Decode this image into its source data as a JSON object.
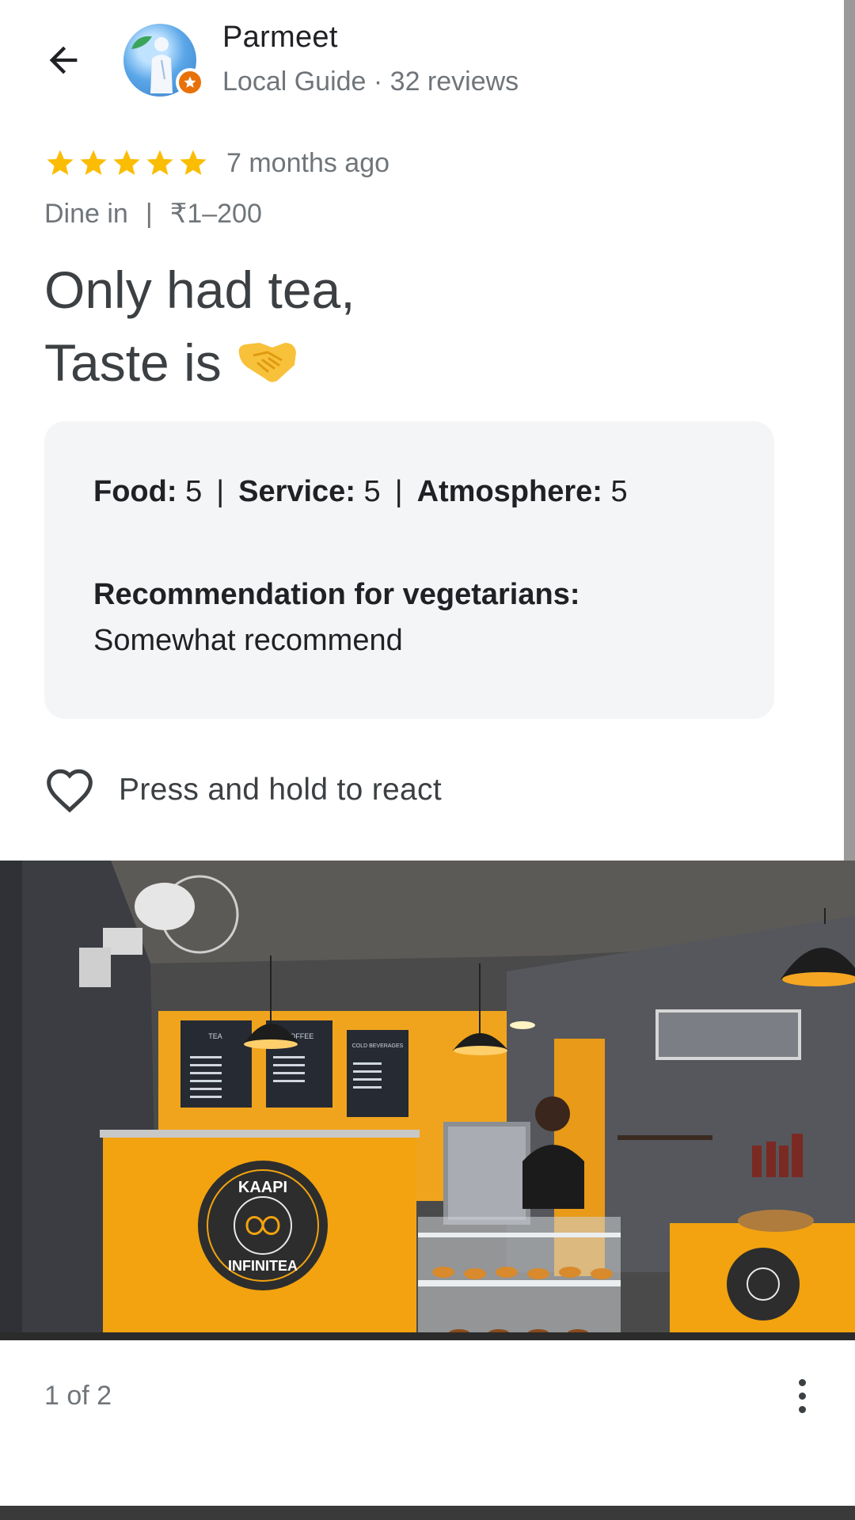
{
  "header": {
    "user_name": "Parmeet",
    "user_meta": "Local Guide · 32 reviews"
  },
  "review": {
    "rating": 5,
    "rating_max": 5,
    "time_ago": "7 months ago",
    "visit_type": "Dine in",
    "visit_separator": "|",
    "price_range": "₹1–200",
    "text_line1": "Only had tea,",
    "text_line2": "Taste is"
  },
  "attributes": {
    "food_label": "Food:",
    "food_value": "5",
    "service_label": "Service:",
    "service_value": "5",
    "atmosphere_label": "Atmosphere:",
    "atmosphere_value": "5",
    "separator": "|",
    "recommendation_label": "Recommendation for vegetarians:",
    "recommendation_value": "Somewhat recommend"
  },
  "react": {
    "label": "Press and hold to react"
  },
  "photo": {
    "counter_label": "1 of 2",
    "logo_text_top": "KAAPI",
    "logo_text_bottom": "INFINITEA",
    "menu_headers": [
      "TEA",
      "COFFEE",
      "COLD BEVERAGES"
    ]
  },
  "colors": {
    "star": "#fbbc04",
    "badge": "#e8710a",
    "attributes_bg": "#f4f5f7",
    "wall_yellow": "#f0a41d"
  }
}
